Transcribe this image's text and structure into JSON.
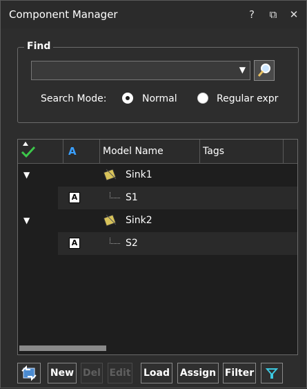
{
  "window": {
    "title": "Component Manager",
    "help_glyph": "?",
    "restore_glyph": "⧉",
    "close_glyph": "✕"
  },
  "find": {
    "legend": "Find",
    "query_value": "",
    "dropdown_glyph": "▼",
    "search_mode_label": "Search Mode:",
    "modes": [
      {
        "label": "Normal",
        "selected": true
      },
      {
        "label": "Regular expr",
        "selected": false
      }
    ]
  },
  "grid": {
    "columns": [
      "",
      "",
      "Model Name",
      "Tags"
    ],
    "header_icon_a": "A",
    "rows": [
      {
        "expander": "▼",
        "name": "Sink1",
        "is_leaf": false
      },
      {
        "a_box": "A",
        "name": "S1",
        "is_leaf": true
      },
      {
        "expander": "▼",
        "name": "Sink2",
        "is_leaf": false
      },
      {
        "a_box": "A",
        "name": "S2",
        "is_leaf": true
      }
    ]
  },
  "toolbar": {
    "buttons": [
      {
        "label": "New",
        "enabled": true
      },
      {
        "label": "Del",
        "enabled": false
      },
      {
        "label": "Edit",
        "enabled": false
      },
      {
        "label": "Load",
        "enabled": true
      },
      {
        "label": "Assign",
        "enabled": true
      },
      {
        "label": "Filter",
        "enabled": true
      }
    ]
  },
  "colors": {
    "background": "#2d2d2d",
    "grid_background": "#1e1e1e",
    "accent_blue": "#3aa0ff",
    "check_green": "#3cc84a"
  }
}
